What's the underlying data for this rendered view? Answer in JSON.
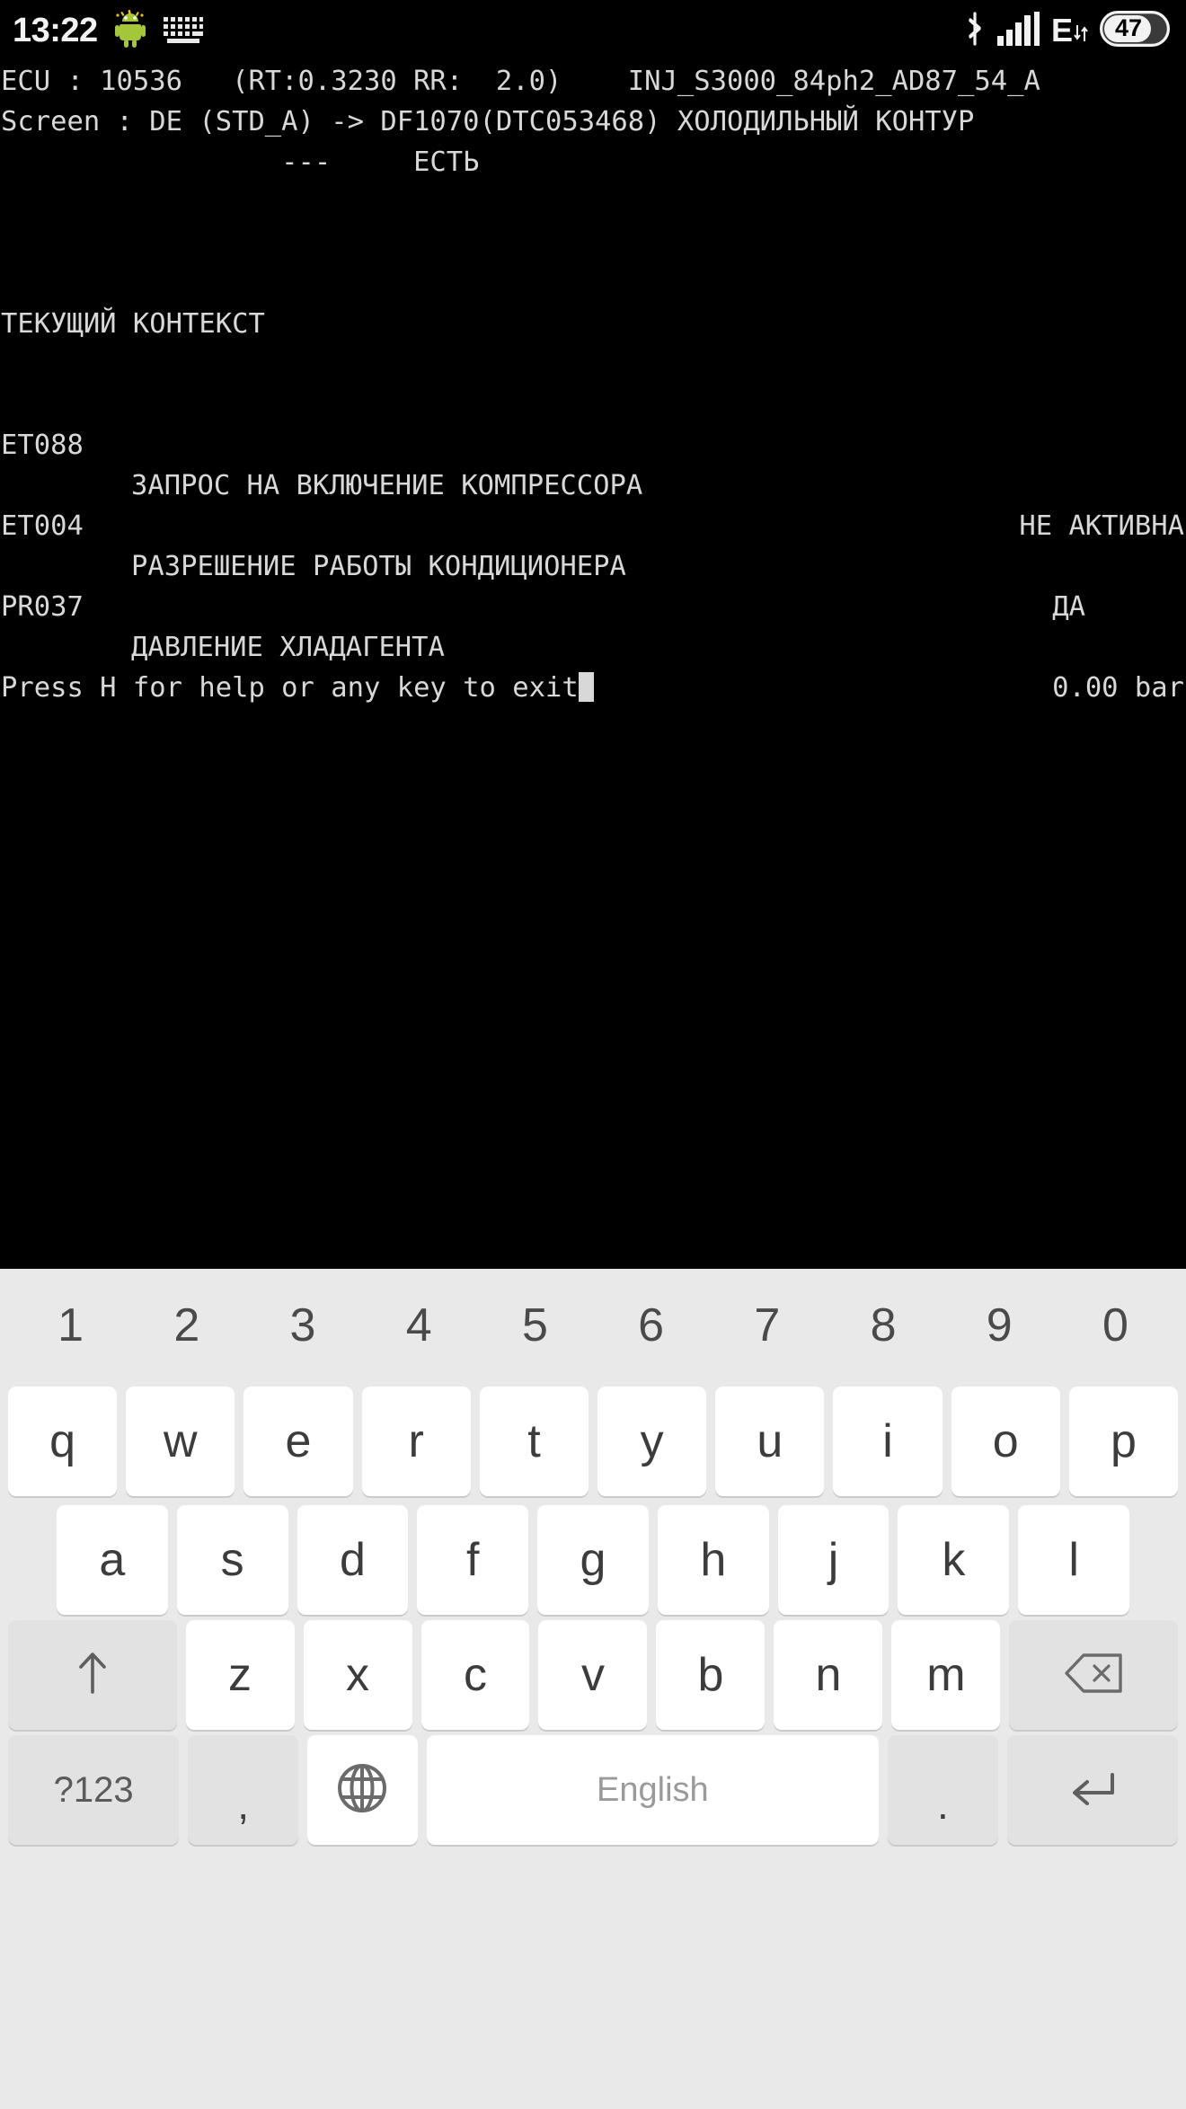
{
  "status_bar": {
    "time": "13:22",
    "icons_left": [
      "android-bug-icon",
      "keyboard-icon"
    ],
    "icons_right": [
      "bluetooth-icon",
      "signal-bars-icon",
      "edge-network-icon",
      "battery-icon"
    ],
    "network_type": "E",
    "battery_level": "47"
  },
  "terminal": {
    "colors": {
      "background": "#000000",
      "text": "#d8d8d8",
      "cursor": "#d8d8d8"
    },
    "line_ecu": "ECU : 10536   (RT:0.3230 RR:  2.0)    INJ_S3000_84ph2_AD87_54_A",
    "line_screen": "Screen : DE (STD_A) -> DF1070(DTC053468) ХОЛОДИЛЬНЫЙ КОНТУР",
    "line_screen_cont": "                 ---     ЕСТЬ",
    "section_title": "ТЕКУЩИЙ КОНТЕКСТ",
    "rows": [
      {
        "id": "ET088",
        "desc": "ЗАПРОС НА ВКЛЮЧЕНИЕ КОМПРЕССОРА",
        "value": "НЕ АКТИВНА"
      },
      {
        "id": "ET004",
        "desc": "РАЗРЕШЕНИЕ РАБОТЫ КОНДИЦИОНЕРА",
        "value": "ДА"
      },
      {
        "id": "PR037",
        "desc": "ДАВЛЕНИЕ ХЛАДАГЕНТА",
        "value": "0.00 bar"
      }
    ],
    "prompt": "Press H for help or any key to exit"
  },
  "keyboard": {
    "background": "#e9e9e9",
    "numbers": [
      "1",
      "2",
      "3",
      "4",
      "5",
      "6",
      "7",
      "8",
      "9",
      "0"
    ],
    "row_qwerty": [
      "q",
      "w",
      "e",
      "r",
      "t",
      "y",
      "u",
      "i",
      "o",
      "p"
    ],
    "row_asdf": [
      "a",
      "s",
      "d",
      "f",
      "g",
      "h",
      "j",
      "k",
      "l"
    ],
    "row_zxcv": [
      "z",
      "x",
      "c",
      "v",
      "b",
      "n",
      "m"
    ],
    "shift_icon": "shift-arrow-up-icon",
    "backspace_icon": "backspace-icon",
    "symbols_label": "?123",
    "comma_label": ",",
    "globe_icon": "language-globe-icon",
    "space_label": "English",
    "period_label": ".",
    "enter_icon": "enter-return-icon"
  }
}
